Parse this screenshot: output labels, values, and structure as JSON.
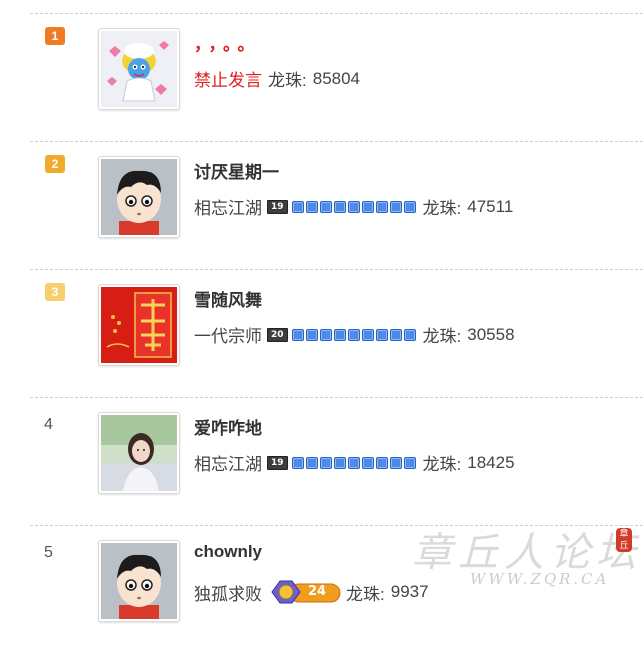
{
  "ranking": {
    "rows": [
      {
        "rank": "1",
        "name": "，，。。",
        "level": "禁止发言",
        "level_icon": "",
        "dragon_label": "龙珠:",
        "dragon_value": "85804"
      },
      {
        "rank": "2",
        "name": "讨厌星期一",
        "level": "相忘江湖",
        "level_icon": "19",
        "dragon_label": "龙珠:",
        "dragon_value": "47511"
      },
      {
        "rank": "3",
        "name": "雪随风舞",
        "level": "一代宗师",
        "level_icon": "20",
        "dragon_label": "龙珠:",
        "dragon_value": "30558"
      },
      {
        "rank": "4",
        "name": "爱咋咋地",
        "level": "相忘江湖",
        "level_icon": "19",
        "dragon_label": "龙珠:",
        "dragon_value": "18425"
      },
      {
        "rank": "5",
        "name": "chownly",
        "level": "独孤求败",
        "level_icon": "24",
        "dragon_label": "龙珠:",
        "dragon_value": "9937"
      }
    ]
  },
  "watermark": {
    "title": "章丘人论坛",
    "url": "WWW.ZQR.CA",
    "seal": "章丘"
  },
  "colors": {
    "rank1": "#ef7b22",
    "rank2": "#f0ab2d",
    "rank3": "#f6cf6f",
    "banned_text": "#e02020",
    "star_blue": "#4a8ae8"
  }
}
